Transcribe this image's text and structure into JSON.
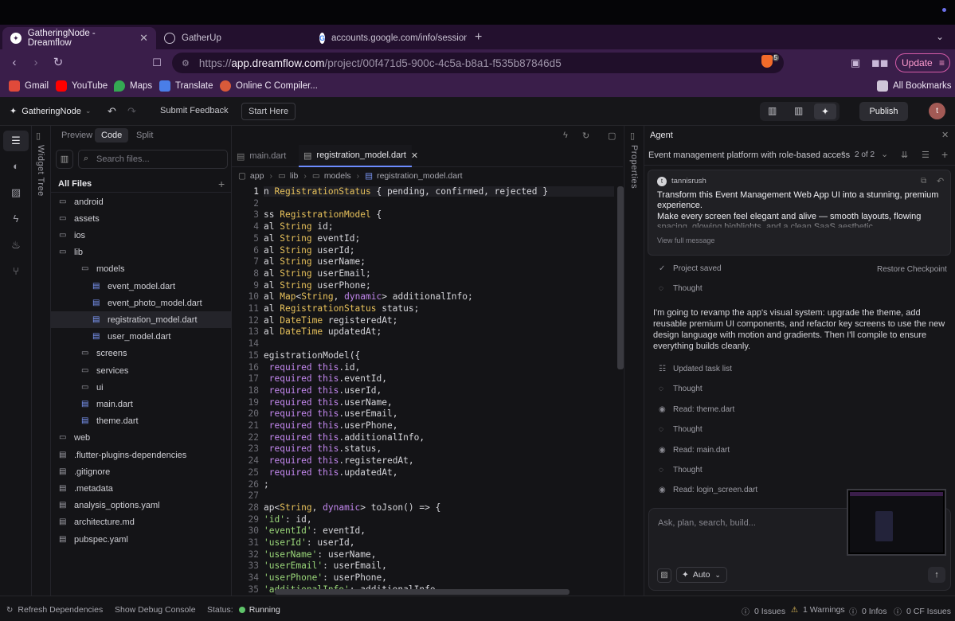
{
  "browser": {
    "tabs": [
      {
        "title": "GatheringNode - Dreamflow",
        "active": true
      },
      {
        "title": "GatherUp",
        "active": false
      },
      {
        "title": "accounts.google.com/info/session",
        "active": false
      }
    ],
    "url_scheme": "https://",
    "url_host": "app.dreamflow.com",
    "url_path": "/project/00f471d5-900c-4c5a-b8a1-f535b87846d5",
    "brave_badge": "5",
    "update_label": "Update",
    "bookmarks": [
      "Gmail",
      "YouTube",
      "Maps",
      "Translate",
      "Online C Compiler..."
    ],
    "all_bookmarks": "All Bookmarks"
  },
  "header": {
    "project_name": "GatheringNode",
    "submit_feedback": "Submit Feedback",
    "start_here": "Start Here",
    "publish": "Publish",
    "avatar_initial": "t"
  },
  "rail": {
    "widget_tree": "Widget Tree"
  },
  "files": {
    "mode_tabs": [
      "Preview",
      "Code",
      "Split"
    ],
    "search_placeholder": "Search files...",
    "all_files": "All Files",
    "tree": [
      {
        "name": "android",
        "type": "folder",
        "depth": 0
      },
      {
        "name": "assets",
        "type": "folder",
        "depth": 0
      },
      {
        "name": "ios",
        "type": "folder",
        "depth": 0
      },
      {
        "name": "lib",
        "type": "folder",
        "depth": 0
      },
      {
        "name": "models",
        "type": "folder",
        "depth": 1
      },
      {
        "name": "event_model.dart",
        "type": "file",
        "depth": 2
      },
      {
        "name": "event_photo_model.dart",
        "type": "file",
        "depth": 2
      },
      {
        "name": "registration_model.dart",
        "type": "file",
        "depth": 2,
        "selected": true
      },
      {
        "name": "user_model.dart",
        "type": "file",
        "depth": 2
      },
      {
        "name": "screens",
        "type": "folder",
        "depth": 1
      },
      {
        "name": "services",
        "type": "folder",
        "depth": 1
      },
      {
        "name": "ui",
        "type": "folder",
        "depth": 1
      },
      {
        "name": "main.dart",
        "type": "file",
        "depth": 1
      },
      {
        "name": "theme.dart",
        "type": "file",
        "depth": 1
      },
      {
        "name": "web",
        "type": "folder",
        "depth": 0
      },
      {
        "name": ".flutter-plugins-dependencies",
        "type": "file",
        "depth": 0
      },
      {
        "name": ".gitignore",
        "type": "file",
        "depth": 0
      },
      {
        "name": ".metadata",
        "type": "file",
        "depth": 0
      },
      {
        "name": "analysis_options.yaml",
        "type": "file",
        "depth": 0
      },
      {
        "name": "architecture.md",
        "type": "file",
        "depth": 0
      },
      {
        "name": "pubspec.yaml",
        "type": "file",
        "depth": 0
      }
    ]
  },
  "editor": {
    "tabs": [
      {
        "title": "main.dart",
        "active": false
      },
      {
        "title": "registration_model.dart",
        "active": true
      }
    ],
    "breadcrumb": [
      "app",
      "lib",
      "models",
      "registration_model.dart"
    ],
    "lines": [
      "n RegistrationStatus { pending, confirmed, rejected }",
      "",
      "ss RegistrationModel {",
      "al String id;",
      "al String eventId;",
      "al String userId;",
      "al String userName;",
      "al String userEmail;",
      "al String userPhone;",
      "al Map<String, dynamic> additionalInfo;",
      "al RegistrationStatus status;",
      "al DateTime registeredAt;",
      "al DateTime updatedAt;",
      "",
      "egistrationModel({",
      " required this.id,",
      " required this.eventId,",
      " required this.userId,",
      " required this.userName,",
      " required this.userEmail,",
      " required this.userPhone,",
      " required this.additionalInfo,",
      " required this.status,",
      " required this.registeredAt,",
      " required this.updatedAt,",
      ";",
      "",
      "ap<String, dynamic> toJson() => {",
      "'id': id,",
      "'eventId': eventId,",
      "'userId': userId,",
      "'userName': userName,",
      "'userEmail': userEmail,",
      "'userPhone': userPhone,",
      "'additionalInfo': additionalInfo,"
    ]
  },
  "properties_label": "Properties",
  "agent": {
    "title": "Agent",
    "thread_title": "Event management platform with role-based access",
    "pager": "2 of 2",
    "user": "tannisrush",
    "user_initial": "t",
    "message_line1": "Transform this Event Management Web App UI into a stunning, premium experience.",
    "message_line2": "Make every screen feel elegant and alive — smooth layouts, flowing spacing, glowing highlights, and a clean SaaS aesthetic.",
    "view_full": "View full message",
    "project_saved": "Project saved",
    "restore": "Restore Checkpoint",
    "thought": "Thought",
    "response": "I'm going to revamp the app's visual system: upgrade the theme, add reusable premium UI components, and refactor key screens to use the new design language with motion and gradients. Then I'll compile to ensure everything builds cleanly.",
    "events": [
      {
        "label": "Updated task list",
        "icon": "list-icon"
      },
      {
        "label": "Thought",
        "icon": "thought-icon"
      },
      {
        "label": "Read: theme.dart",
        "icon": "eye-icon"
      },
      {
        "label": "Thought",
        "icon": "thought-icon"
      },
      {
        "label": "Read: main.dart",
        "icon": "eye-icon"
      },
      {
        "label": "Thought",
        "icon": "thought-icon"
      },
      {
        "label": "Read: login_screen.dart",
        "icon": "eye-icon"
      }
    ],
    "input_placeholder": "Ask, plan, search, build...",
    "mode": "Auto"
  },
  "status": {
    "refresh": "Refresh Dependencies",
    "debug": "Show Debug Console",
    "status_label": "Status:",
    "status_value": "Running",
    "issues": "0 Issues",
    "warnings": "1 Warnings",
    "infos": "0 Infos",
    "cf_issues": "0 CF Issues"
  },
  "colors": {
    "accent": "#6d8cff",
    "keyword": "#e8c25b",
    "type_keyword": "#c488f0",
    "string": "#9bd87a",
    "running": "#5fc46a",
    "browser_chrome": "#3a1e4a"
  }
}
